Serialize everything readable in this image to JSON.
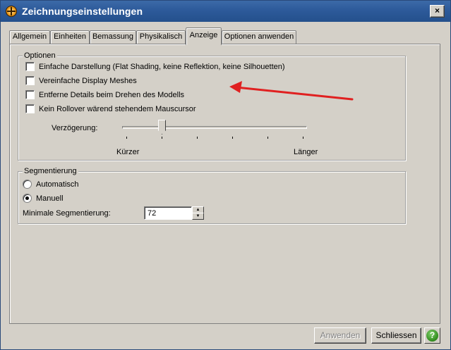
{
  "window": {
    "title": "Zeichnungseinstellungen",
    "close_glyph": "×"
  },
  "tabs": [
    {
      "label": "Allgemein"
    },
    {
      "label": "Einheiten"
    },
    {
      "label": "Bemassung"
    },
    {
      "label": "Physikalisch"
    },
    {
      "label": "Anzeige",
      "active": true
    },
    {
      "label": "Optionen anwenden"
    }
  ],
  "options": {
    "group_label": "Optionen",
    "checkboxes": [
      {
        "label": "Einfache Darstellung (Flat Shading, keine Reflektion, keine Silhouetten)",
        "checked": false
      },
      {
        "label": "Vereinfache Display Meshes",
        "checked": false
      },
      {
        "label": "Entferne Details beim Drehen des Modells",
        "checked": false
      },
      {
        "label": "Kein Rollover wärend stehendem Mauscursor",
        "checked": false
      }
    ],
    "delay_label": "Verzögerung:",
    "slider_min_label": "Kürzer",
    "slider_max_label": "Länger",
    "slider_level": 0.2,
    "slider_ticks": 6
  },
  "segmentation": {
    "group_label": "Segmentierung",
    "radios": [
      {
        "label": "Automatisch",
        "checked": false
      },
      {
        "label": "Manuell",
        "checked": true
      }
    ],
    "min_label": "Minimale Segmentierung:",
    "min_value": "72"
  },
  "footer": {
    "apply_label": "Anwenden",
    "close_label": "Schliessen",
    "help_glyph": "?"
  },
  "annotation": {
    "arrow_color": "#e02020"
  },
  "colors": {
    "title_bar": "#2d5a9a",
    "dialog_bg": "#d4d0c8"
  }
}
